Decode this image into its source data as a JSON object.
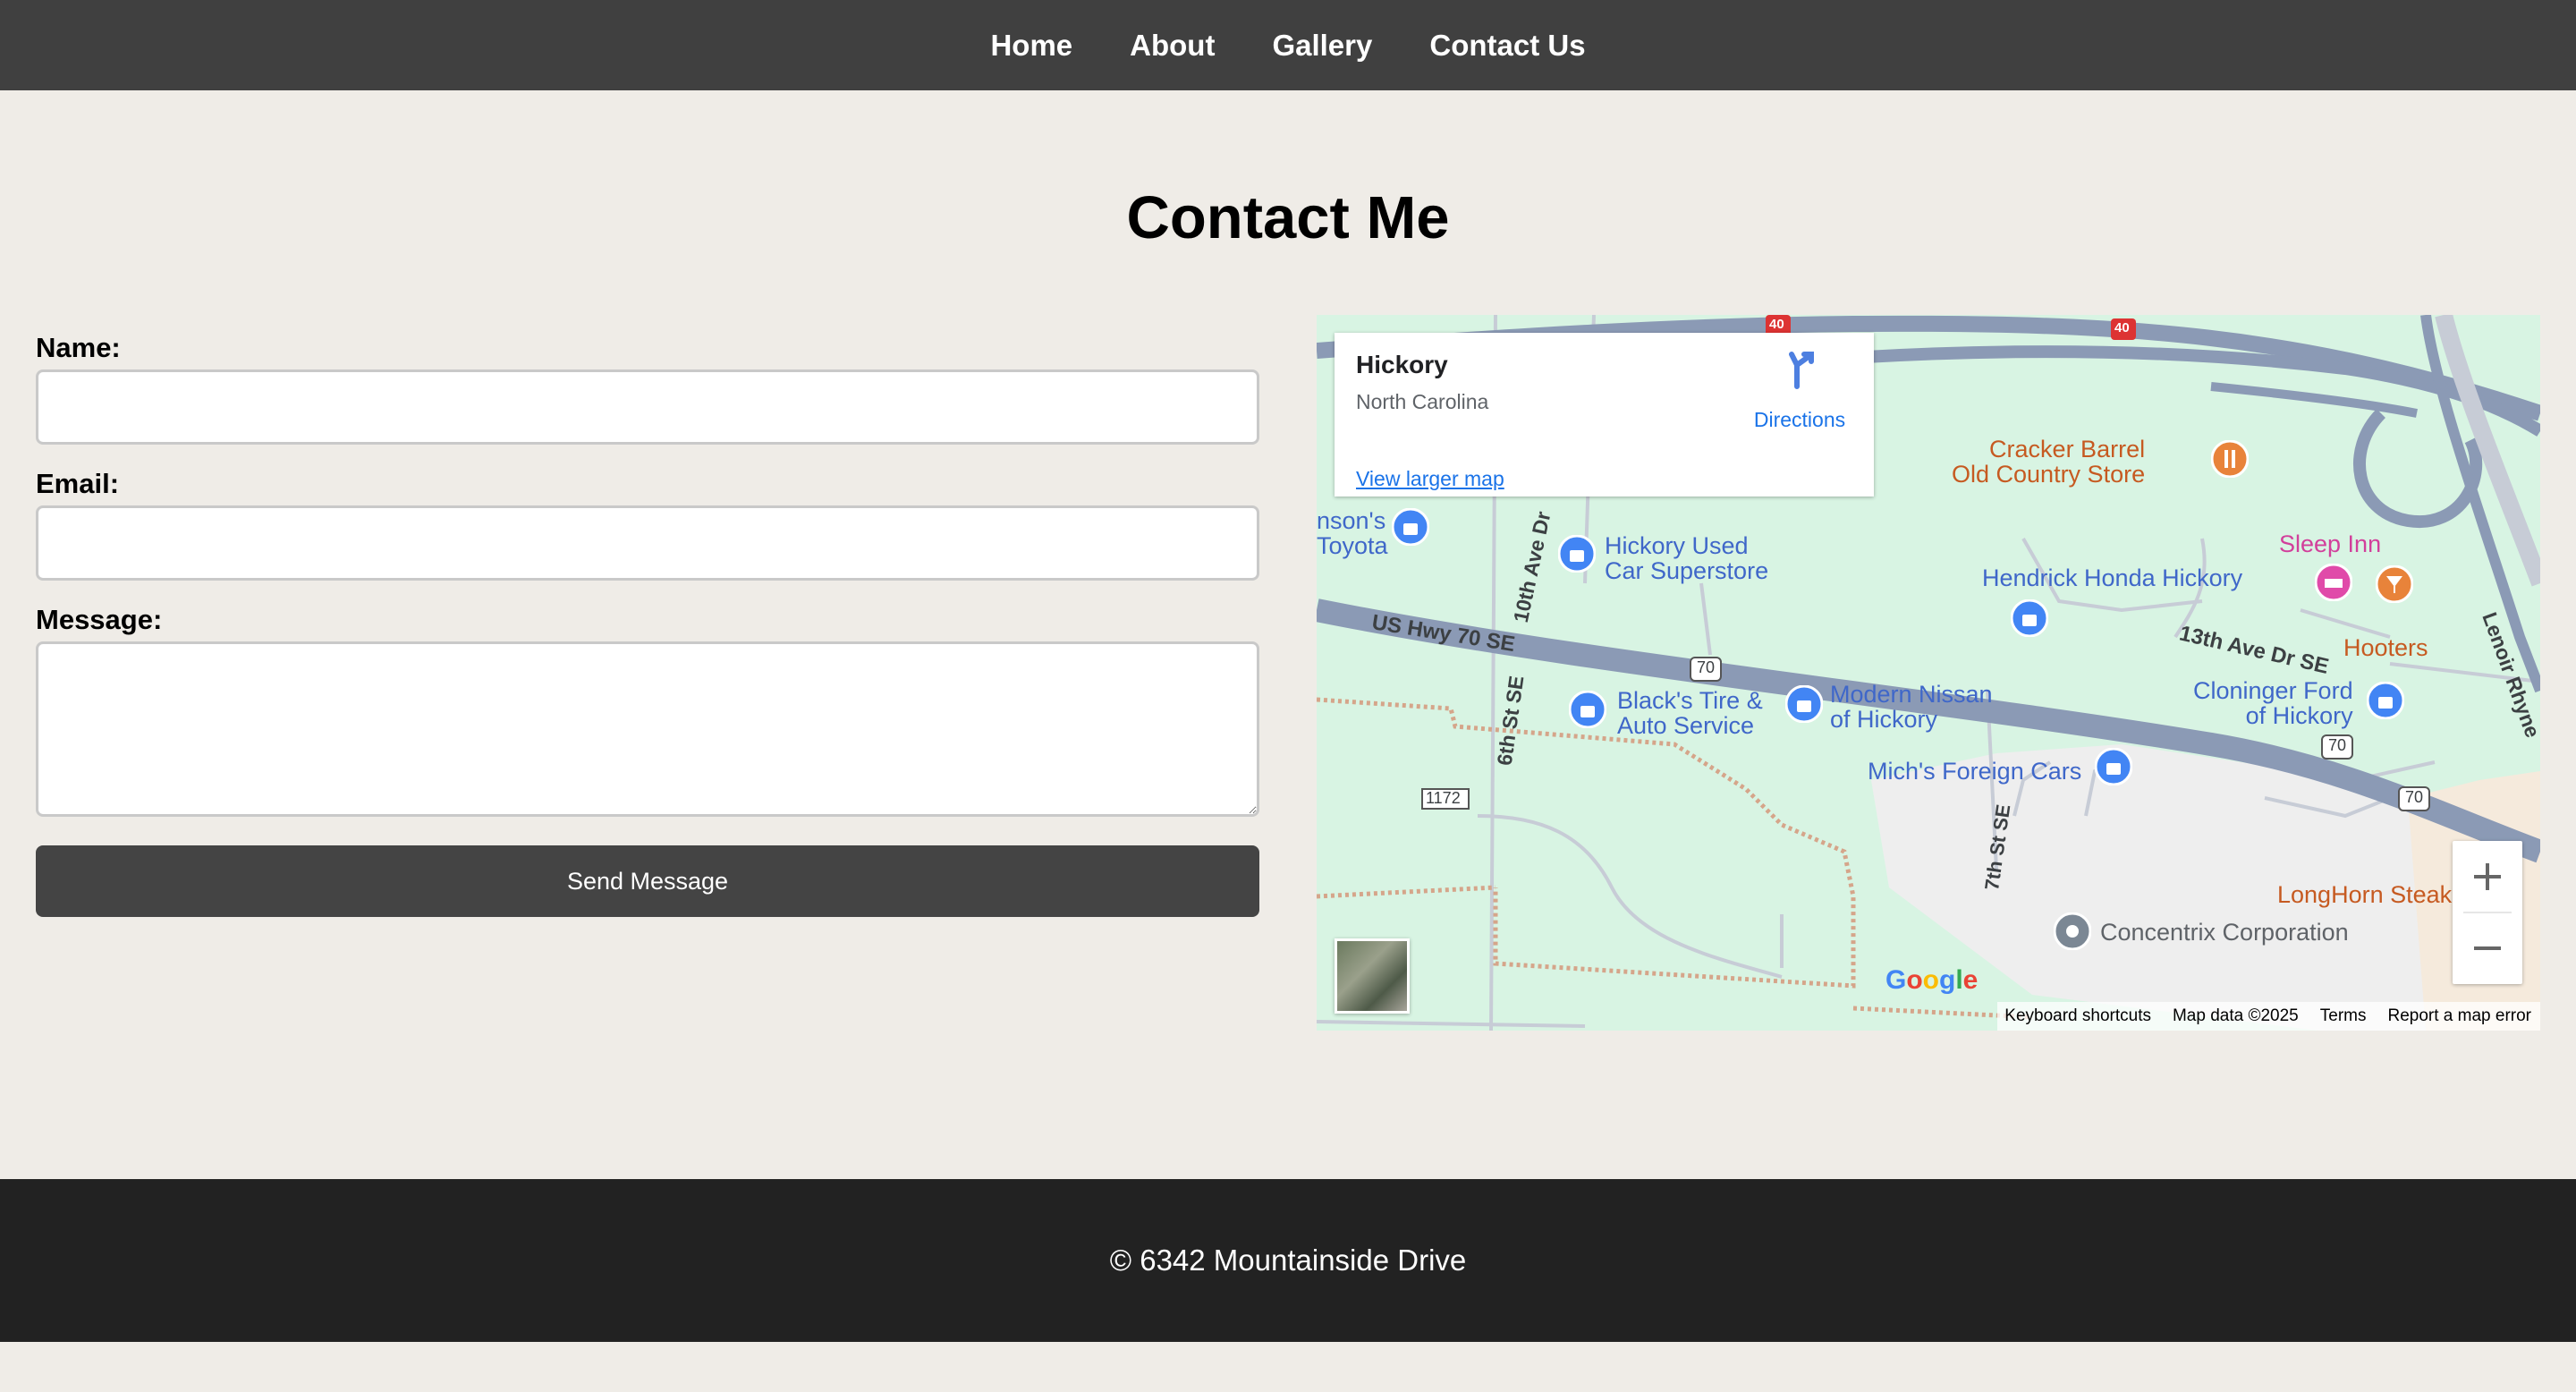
{
  "nav": {
    "items": [
      "Home",
      "About",
      "Gallery",
      "Contact Us"
    ]
  },
  "heading": "Contact Me",
  "form": {
    "name_label": "Name:",
    "email_label": "Email:",
    "message_label": "Message:",
    "name_value": "",
    "email_value": "",
    "message_value": "",
    "submit_label": "Send Message"
  },
  "map": {
    "card": {
      "title": "Hickory",
      "subtitle": "North Carolina",
      "directions": "Directions",
      "larger_map": "View larger map"
    },
    "pois": {
      "johnsons_toyota_1": "nson's",
      "johnsons_toyota_2": "Toyota",
      "hickory_used_1": "Hickory Used",
      "hickory_used_2": "Car Superstore",
      "cracker_barrel_1": "Cracker Barrel",
      "cracker_barrel_2": "Old Country Store",
      "sleep_inn": "Sleep Inn",
      "hendrick": "Hendrick Honda Hickory",
      "hooters": "Hooters",
      "blacks_tire_1": "Black's Tire &",
      "blacks_tire_2": "Auto Service",
      "modern_nissan_1": "Modern Nissan",
      "modern_nissan_2": "of Hickory",
      "cloninger_1": "Cloninger Ford",
      "cloninger_2": "of Hickory",
      "michs": "Mich's Foreign Cars",
      "longhorn": "LongHorn Steak",
      "concentrix": "Concentrix Corporation"
    },
    "roads": {
      "us70": "US Hwy 70 SE",
      "tenth_ave": "10th Ave Dr",
      "sixth_st": "6th St SE",
      "thirteenth_ave": "13th Ave Dr SE",
      "seventh_st": "7th St SE",
      "lenoir": "Lenoir Rhyne",
      "shield_70": "70",
      "shield_40": "40",
      "route_1172": "1172"
    },
    "attribution": {
      "keyboard": "Keyboard shortcuts",
      "mapdata": "Map data ©2025",
      "terms": "Terms",
      "report": "Report a map error"
    },
    "google": "Google"
  },
  "footer": {
    "text": "© 6342 Mountainside Drive"
  }
}
